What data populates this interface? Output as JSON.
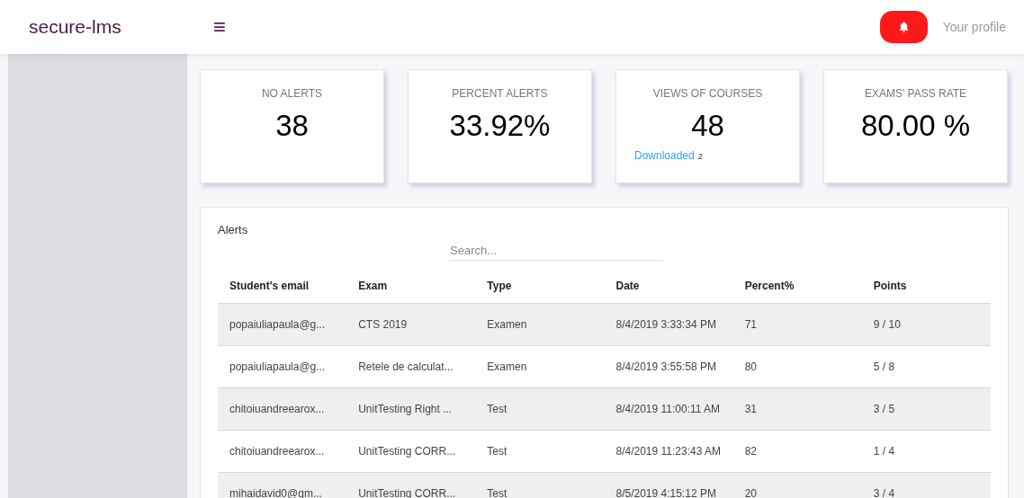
{
  "header": {
    "brand": "secure-lms",
    "menu_icon": "≡",
    "profile": "Your profile"
  },
  "stats": [
    {
      "title": "NO ALERTS",
      "value": "38"
    },
    {
      "title": "PERCENT ALERTS",
      "value": "33.92%"
    },
    {
      "title": "VIEWS OF COURSES",
      "value": "48",
      "link": "Downloaded",
      "link_count": "2"
    },
    {
      "title": "EXAMS' PASS RATE",
      "value": "80.00 %"
    }
  ],
  "alerts": {
    "title": "Alerts",
    "search": {
      "placeholder": "Search..."
    },
    "columns": [
      "Student's email",
      "Exam",
      "Type",
      "Date",
      "Percent%",
      "Points"
    ],
    "rows": [
      [
        "popaiuliapaula@g...",
        "CTS 2019",
        "Examen",
        "8/4/2019 3:33:34 PM",
        "71",
        "9 / 10"
      ],
      [
        "popaiuliapaula@g...",
        "Retele de calculat...",
        "Examen",
        "8/4/2019 3:55:58 PM",
        "80",
        "5 / 8"
      ],
      [
        "chitoiuandreearox...",
        "UnitTesting Right ...",
        "Test",
        "8/4/2019 11:00:11 AM",
        "31",
        "3 / 5"
      ],
      [
        "chitoiuandreearox...",
        "UnitTesting CORR...",
        "Test",
        "8/4/2019 11:23:43 AM",
        "82",
        "1 / 4"
      ],
      [
        "mihaidavid0@gm...",
        "UnitTesting CORR...",
        "Test",
        "8/5/2019 4:15:12 PM",
        "20",
        "3 / 4"
      ]
    ]
  }
}
